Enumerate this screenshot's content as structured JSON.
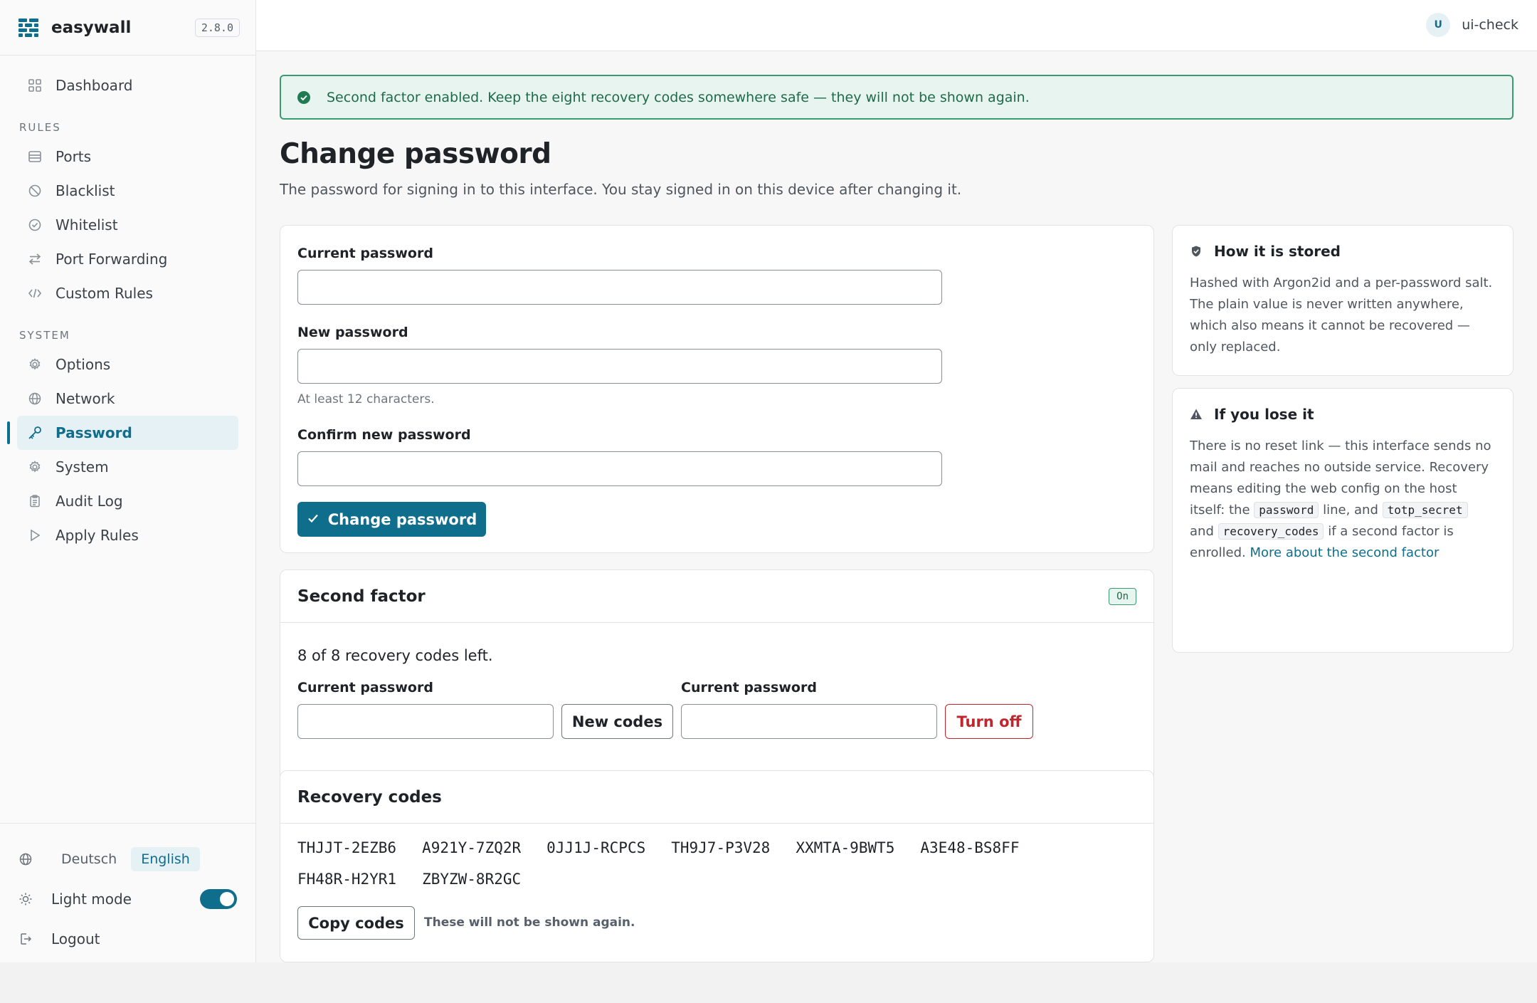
{
  "app": {
    "name": "easywall",
    "version": "2.8.0"
  },
  "user": {
    "initial": "U",
    "name": "ui-check"
  },
  "nav": {
    "dashboard": "Dashboard",
    "rules_section": "RULES",
    "ports": "Ports",
    "blacklist": "Blacklist",
    "whitelist": "Whitelist",
    "port_forwarding": "Port Forwarding",
    "custom_rules": "Custom Rules",
    "system_section": "SYSTEM",
    "options": "Options",
    "network": "Network",
    "password": "Password",
    "system": "System",
    "audit_log": "Audit Log",
    "apply_rules": "Apply Rules",
    "active": "Password"
  },
  "footer": {
    "languages": [
      "Deutsch",
      "English"
    ],
    "active_language": "English",
    "theme_label": "Light mode",
    "theme_toggle_on": true,
    "logout": "Logout"
  },
  "alert": {
    "type": "success",
    "message": "Second factor enabled. Keep the eight recovery codes somewhere safe — they will not be shown again."
  },
  "page": {
    "title": "Change password",
    "subtitle": "The password for signing in to this interface. You stay signed in on this device after changing it."
  },
  "password_form": {
    "current_label": "Current password",
    "new_label": "New password",
    "new_hint": "At least 12 characters.",
    "confirm_label": "Confirm new password",
    "submit": "Change password"
  },
  "second_factor": {
    "title": "Second factor",
    "status": "On",
    "codes_left": "8 of 8 recovery codes left.",
    "regen_label": "Current password",
    "regen_button": "New codes",
    "disable_label": "Current password",
    "disable_button": "Turn off"
  },
  "recovery": {
    "title": "Recovery codes",
    "codes": [
      "THJJT-2EZB6",
      "A921Y-7ZQ2R",
      "0JJ1J-RCPCS",
      "TH9J7-P3V28",
      "XXMTA-9BWT5",
      "A3E48-BS8FF",
      "FH48R-H2YR1",
      "ZBYZW-8R2GC"
    ],
    "copy_button": "Copy codes",
    "note": "These will not be shown again."
  },
  "info_stored": {
    "title": "How it is stored",
    "text": "Hashed with Argon2id and a per-password salt. The plain value is never written anywhere, which also means it cannot be recovered — only replaced."
  },
  "info_lose": {
    "title": "If you lose it",
    "text_1": "There is no reset link — this interface sends no mail and reaches no outside service. Recovery means editing the web config on the host itself: the",
    "code_1": "password",
    "text_2": "line, and",
    "code_2": "totp_secret",
    "text_3": "and",
    "code_3": "recovery_codes",
    "text_4": "if a second factor is enrolled.",
    "link": "More about the second factor"
  },
  "colors": {
    "accent": "#0f6e8c",
    "success": "#3a9b72",
    "danger": "#c0262d"
  },
  "icons": {
    "logo": "firewall-bricks-icon",
    "dashboard": "grid-icon",
    "ports": "database-icon",
    "blacklist": "ban-icon",
    "whitelist": "check-circle-icon",
    "port_forwarding": "arrows-swap-icon",
    "custom_rules": "code-icon",
    "options": "gear-icon",
    "network": "globe-icon",
    "password": "key-icon",
    "system": "gear-icon",
    "audit_log": "clipboard-icon",
    "apply_rules": "play-icon",
    "language": "globe-icon",
    "theme": "sun-icon",
    "logout": "logout-icon",
    "alert": "check-circle-filled-icon",
    "stored": "shield-icon",
    "lose": "warning-triangle-icon"
  }
}
